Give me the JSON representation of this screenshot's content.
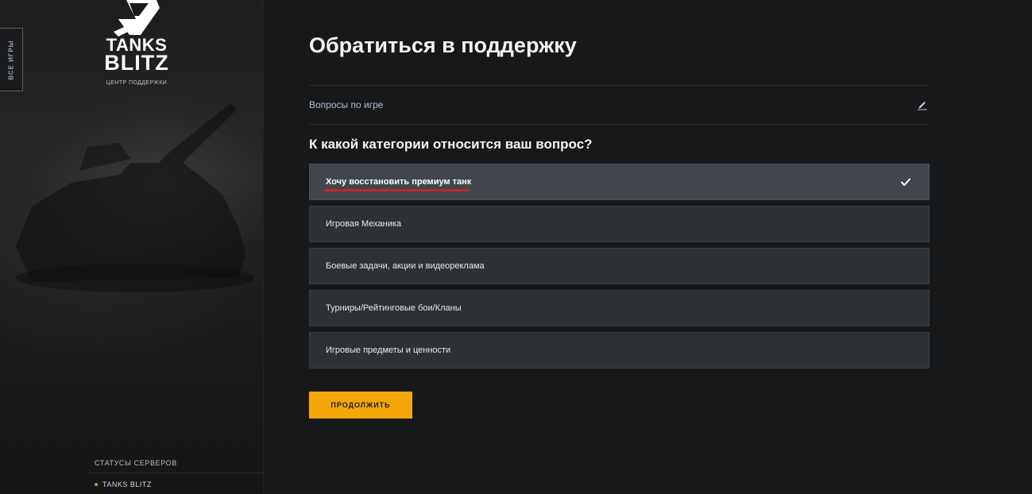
{
  "sidebar": {
    "all_games_label": "ВСЕ ИГРЫ",
    "logo": {
      "line1": "TANKS",
      "line2": "BLITZ",
      "subtitle": "ЦЕНТР ПОДДЕРЖКИ",
      "icon": "tanks-blitz-emblem-icon"
    },
    "server_status": {
      "heading": "СТАТУСЫ СЕРВЕРОВ",
      "items": [
        {
          "label": "TANKS BLITZ",
          "status_color": "#6fbf3f"
        }
      ]
    }
  },
  "main": {
    "title": "Обратиться в поддержку",
    "selected_topic": {
      "label": "Вопросы по игре",
      "icon": "pencil-edit-icon"
    },
    "question": "К какой категории относится ваш вопрос?",
    "options": [
      {
        "label": "Хочу восстановить премиум танк",
        "selected": true
      },
      {
        "label": "Игровая Механика",
        "selected": false
      },
      {
        "label": "Боевые задачи, акции и видеореклама",
        "selected": false
      },
      {
        "label": "Турниры/Рейтинговые бои/Кланы",
        "selected": false
      },
      {
        "label": "Игровые предметы и ценности",
        "selected": false
      }
    ],
    "continue_label": "ПРОДОЛЖИТЬ"
  },
  "colors": {
    "accent": "#f5a607",
    "annotation_underline": "#c0272d",
    "topic_link": "#a9c0d6"
  }
}
